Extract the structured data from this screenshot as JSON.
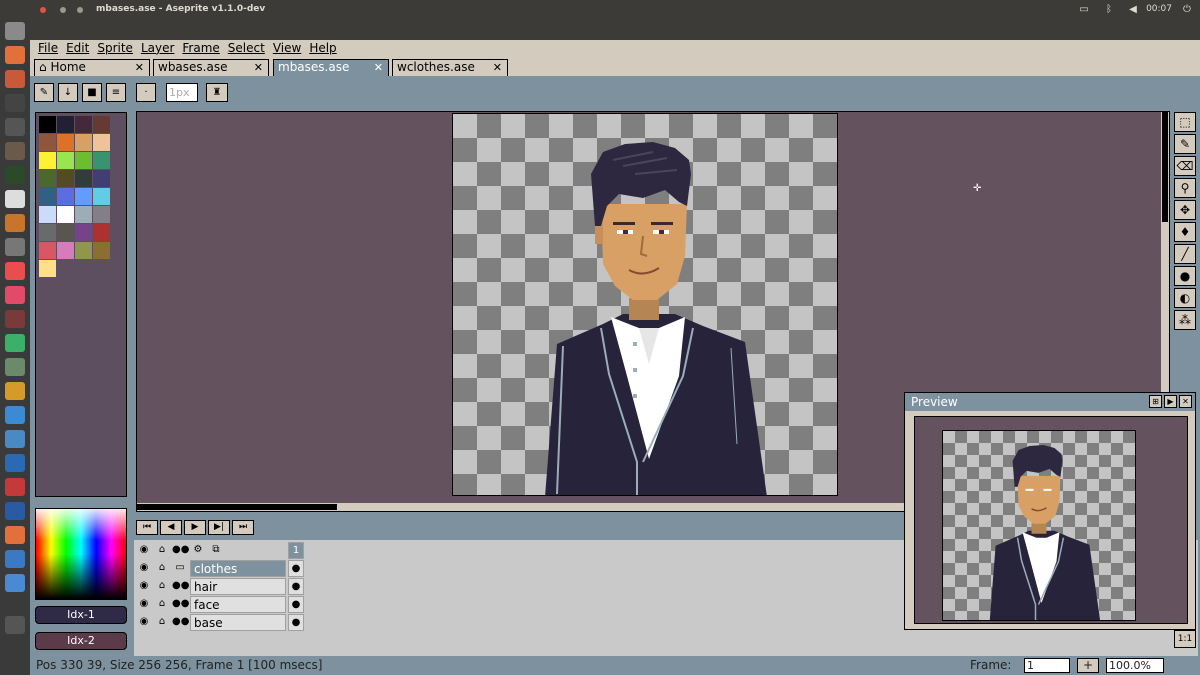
{
  "window": {
    "title": "mbases.ase - Aseprite v1.1.0-dev",
    "clock": "00:07"
  },
  "menu": [
    "File",
    "Edit",
    "Sprite",
    "Layer",
    "Frame",
    "Select",
    "View",
    "Help"
  ],
  "tabs": [
    {
      "label": "Home",
      "icon": "home-icon"
    },
    {
      "label": "wbases.ase"
    },
    {
      "label": "mbases.ase",
      "active": true
    },
    {
      "label": "wclothes.ase"
    }
  ],
  "context_bar": {
    "brush_size": "1px"
  },
  "palette": {
    "colors": [
      "#000000",
      "#222034",
      "#45283c",
      "#663931",
      "#8f563b",
      "#df7126",
      "#d9a066",
      "#eec39a",
      "#fbf236",
      "#99e550",
      "#6abe30",
      "#37946e",
      "#4b692f",
      "#524b24",
      "#323c39",
      "#3f3f74",
      "#306082",
      "#5b6ee1",
      "#639bff",
      "#5fcde4",
      "#cbdbfc",
      "#ffffff",
      "#9badb7",
      "#847e87",
      "#696a6a",
      "#595652",
      "#76428a",
      "#ac3232",
      "#d95763",
      "#d77bba",
      "#8f974a",
      "#8a6f30",
      "#ffe08a"
    ]
  },
  "color_buttons": {
    "fg_label": "Idx-1",
    "bg_label": "Idx-2",
    "fg_color": "#2f2a45",
    "bg_color": "#5b3a4a"
  },
  "timeline": {
    "frame_number": "1",
    "layers": [
      {
        "name": "clothes",
        "active": true
      },
      {
        "name": "hair"
      },
      {
        "name": "face"
      },
      {
        "name": "base"
      }
    ]
  },
  "status": {
    "text": "Pos 330 39, Size 256 256, Frame 1 [100 msecs]",
    "frame_label": "Frame:",
    "frame_value": "1",
    "zoom": "100.0%"
  },
  "preview": {
    "title": "Preview"
  },
  "one_to_one": "1:1",
  "colors": {
    "skin": "#d9a066",
    "hair": "#2d2840",
    "suit": "#26233b",
    "shirt": "#ffffff",
    "canvas_bg": "#64535e",
    "ui_blue": "#7d929e",
    "ui_beige": "#d3cbbe"
  }
}
